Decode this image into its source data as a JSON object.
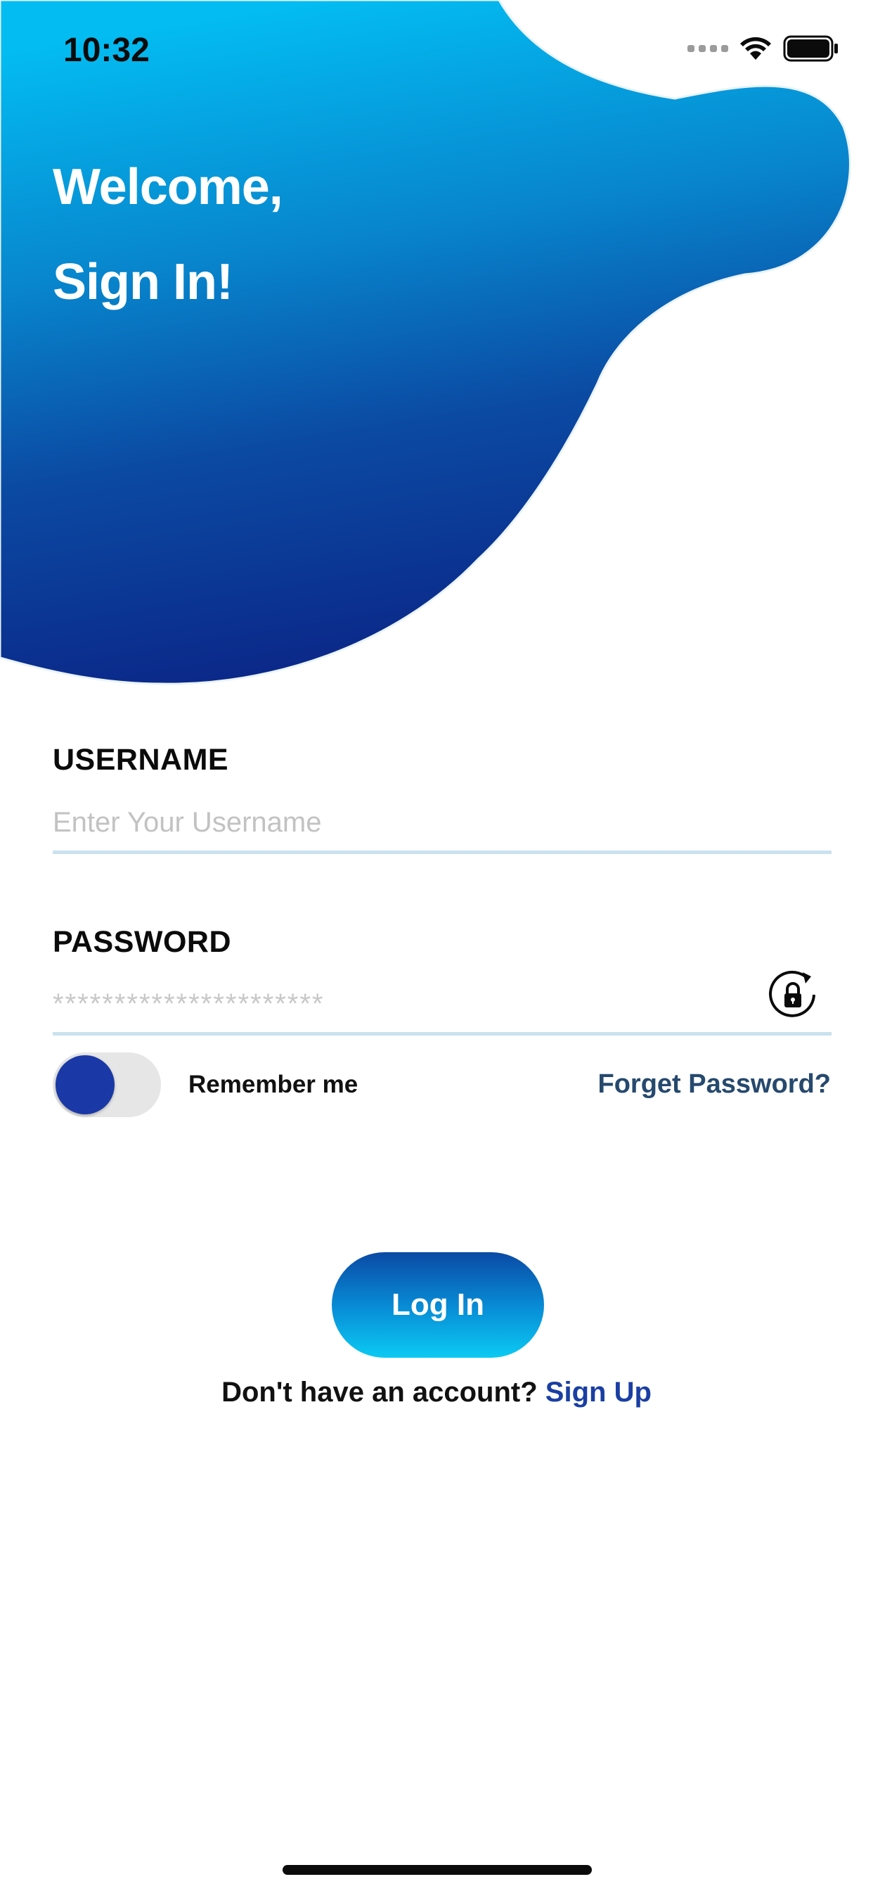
{
  "status_bar": {
    "time": "10:32"
  },
  "header": {
    "line1": "Welcome,",
    "line2": "Sign In!"
  },
  "form": {
    "username_label": "USERNAME",
    "username_placeholder": "Enter Your Username",
    "password_label": "PASSWORD",
    "password_placeholder": "**********************",
    "remember_label": "Remember me",
    "remember_on": true,
    "forgot_label": "Forget Password?",
    "login_label": "Log In",
    "no_account_text": "Don't have an account?",
    "signup_label": "Sign Up"
  },
  "icons": {
    "wifi": "wifi-icon",
    "battery": "battery-icon",
    "cellular": "cellular-icon",
    "password_toggle": "lock-rotate-icon"
  },
  "colors": {
    "gradient_top": "#03bff2",
    "gradient_bottom": "#0b248a",
    "knob": "#1a39a6",
    "link": "#1a3fa3",
    "forgot": "#26496e",
    "underline": "#c9e2ee"
  }
}
